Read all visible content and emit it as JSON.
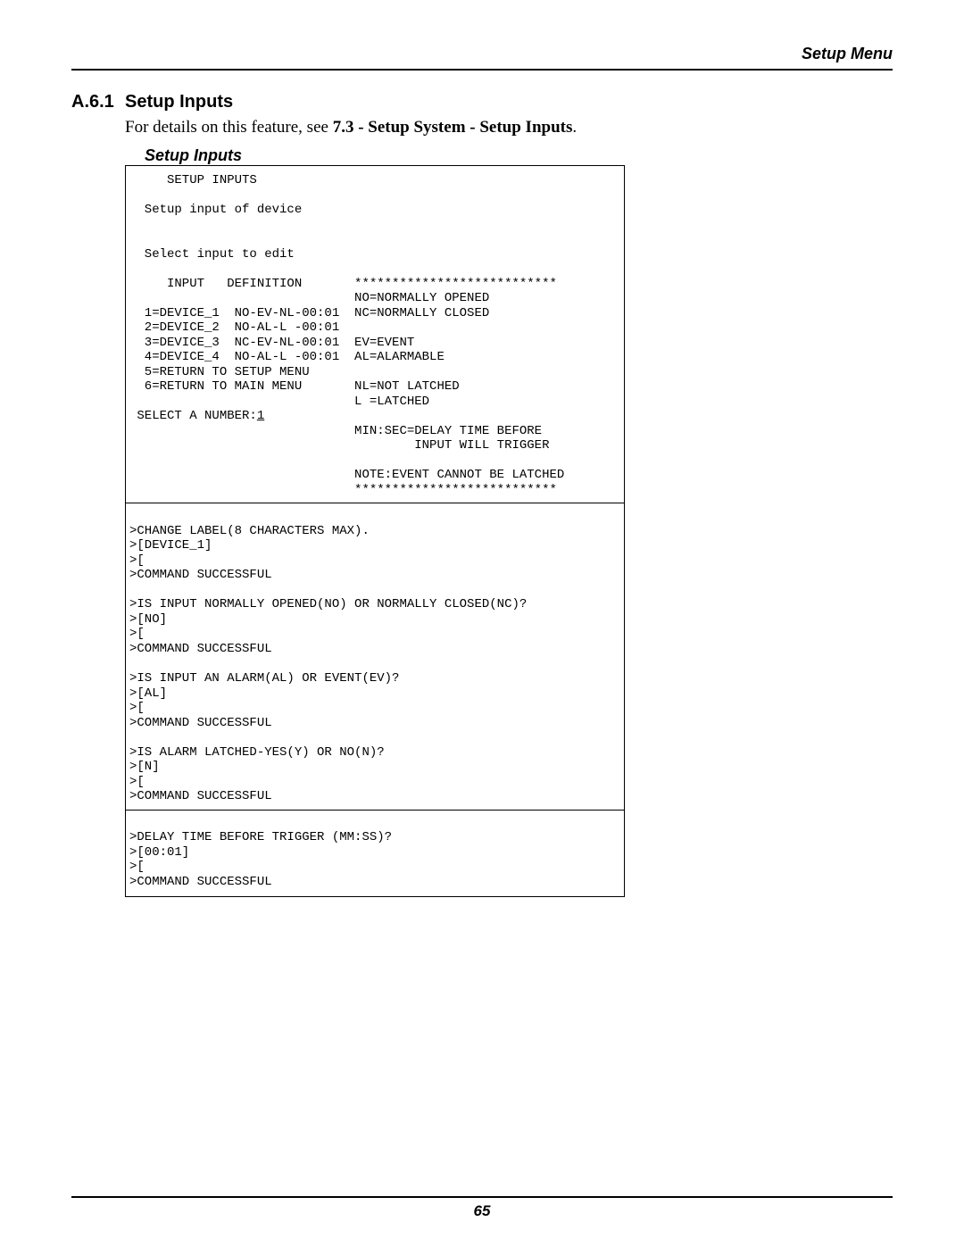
{
  "header": {
    "label": "Setup Menu"
  },
  "section": {
    "number": "A.6.1",
    "title": "Setup Inputs",
    "intro_prefix": "For details on this feature, see ",
    "intro_bold": "7.3 - Setup System - Setup Inputs",
    "intro_suffix": ".",
    "figure_caption": "Setup Inputs"
  },
  "terminal": {
    "top_block": [
      "     SETUP INPUTS",
      "",
      "  Setup input of device",
      "",
      "",
      "  Select input to edit",
      "",
      "     INPUT   DEFINITION       ***************************",
      "                              NO=NORMALLY OPENED",
      "  1=DEVICE_1  NO-EV-NL-00:01  NC=NORMALLY CLOSED",
      "  2=DEVICE_2  NO-AL-L -00:01",
      "  3=DEVICE_3  NC-EV-NL-00:01  EV=EVENT",
      "  4=DEVICE_4  NO-AL-L -00:01  AL=ALARMABLE",
      "  5=RETURN TO SETUP MENU",
      "  6=RETURN TO MAIN MENU       NL=NOT LATCHED",
      "                              L =LATCHED",
      " SELECT A NUMBER:",
      "                              MIN:SEC=DELAY TIME BEFORE",
      "                                      INPUT WILL TRIGGER",
      "",
      "                              NOTE:EVENT CANNOT BE LATCHED",
      "                              ***************************"
    ],
    "select_value": "1",
    "middle_block": [
      "",
      ">CHANGE LABEL(8 CHARACTERS MAX).",
      ">[DEVICE_1]",
      ">[",
      ">COMMAND SUCCESSFUL",
      "",
      ">IS INPUT NORMALLY OPENED(NO) OR NORMALLY CLOSED(NC)?",
      ">[NO]",
      ">[",
      ">COMMAND SUCCESSFUL",
      "",
      ">IS INPUT AN ALARM(AL) OR EVENT(EV)?",
      ">[AL]",
      ">[",
      ">COMMAND SUCCESSFUL",
      "",
      ">IS ALARM LATCHED-YES(Y) OR NO(N)?",
      ">[N]",
      ">[",
      ">COMMAND SUCCESSFUL"
    ],
    "bottom_block": [
      "",
      ">DELAY TIME BEFORE TRIGGER (MM:SS)?",
      ">[00:01]",
      ">[",
      ">COMMAND SUCCESSFUL"
    ]
  },
  "footer": {
    "page_number": "65"
  }
}
